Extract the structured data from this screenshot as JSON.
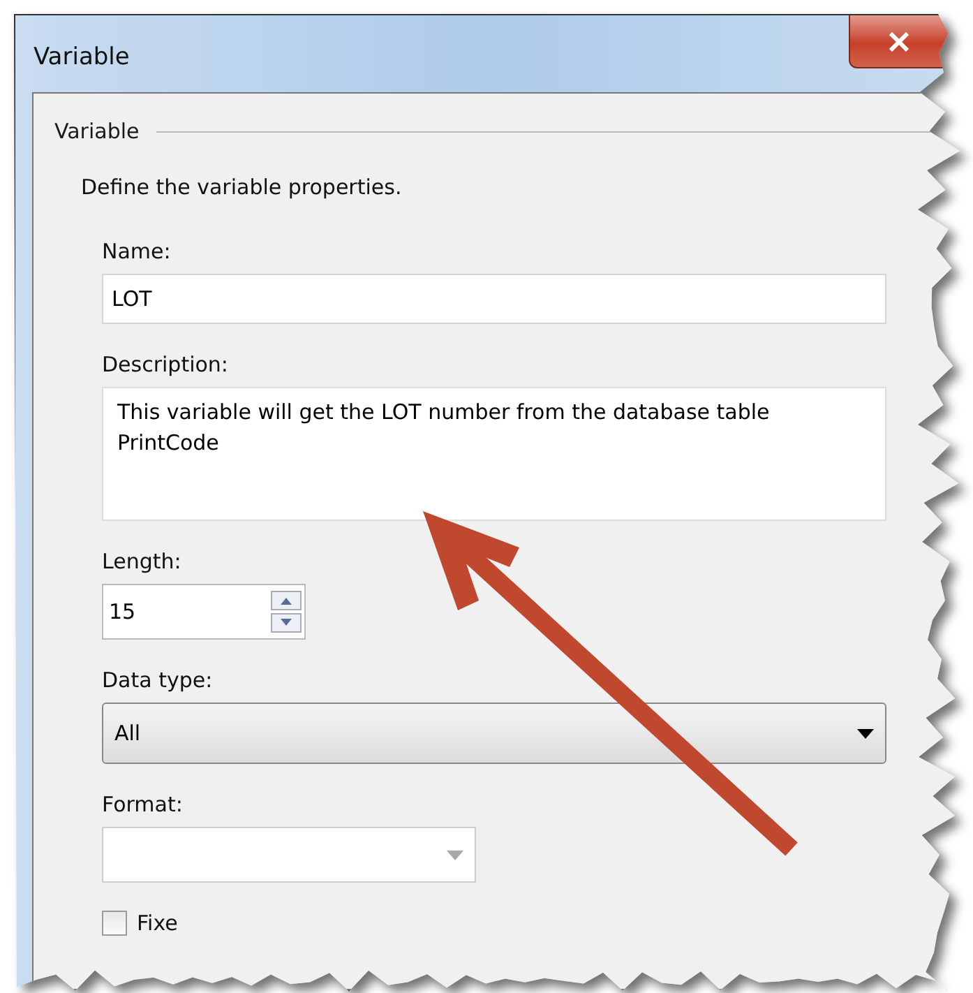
{
  "window": {
    "title": "Variable"
  },
  "group": {
    "title": "Variable",
    "description": "Define the variable properties."
  },
  "fields": [
    {
      "kind": "text",
      "label": "Name:",
      "value": "LOT"
    },
    {
      "kind": "multiline",
      "label": "Description:",
      "value": "This variable will get the LOT number from the database table PrintCode"
    },
    {
      "kind": "spinner",
      "label": "Length:",
      "value": "15"
    },
    {
      "kind": "dropdown",
      "label": "Data type:",
      "value": "All"
    },
    {
      "kind": "combo",
      "label": "Format:"
    }
  ],
  "checkbox": {
    "label": "Fixe",
    "checked": false
  }
}
